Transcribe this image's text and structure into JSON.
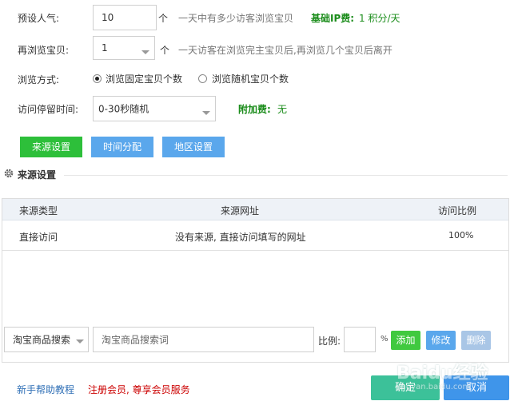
{
  "form": {
    "preset_label": "预设人气:",
    "preset_value": "10",
    "preset_unit": "个",
    "preset_hint": "一天中有多少访客浏览宝贝",
    "base_fee_label": "基础IP费:",
    "base_fee_value": "1 积分/天",
    "rebrowse_label": "再浏览宝贝:",
    "rebrowse_value": "1",
    "rebrowse_unit": "个",
    "rebrowse_hint": "一天访客在浏览完主宝贝后,再浏览几个宝贝后离开",
    "mode_label": "浏览方式:",
    "mode_option_fixed": "浏览固定宝贝个数",
    "mode_option_random": "浏览随机宝贝个数",
    "stay_label": "访问停留时间:",
    "stay_value": "0-30秒随机",
    "extra_fee_label": "附加费:",
    "extra_fee_value": "无"
  },
  "tabs": {
    "source": "来源设置",
    "time": "时间分配",
    "region": "地区设置"
  },
  "section": {
    "title": "来源设置"
  },
  "table": {
    "headers": [
      "来源类型",
      "来源网址",
      "访问比例"
    ],
    "rows": [
      {
        "type": "直接访问",
        "url": "没有来源, 直接访问填写的网址",
        "ratio": "100%"
      }
    ]
  },
  "add_row": {
    "source_select": "淘宝商品搜索",
    "keyword_placeholder": "淘宝商品搜索词",
    "ratio_label": "比例:",
    "percent": "%",
    "add": "添加",
    "edit": "修改",
    "delete": "删除"
  },
  "footer": {
    "help_link": "新手帮助教程",
    "register_link": "注册会员, 尊享会员服务",
    "confirm": "确定",
    "cancel": "取消"
  },
  "watermark": {
    "brand": "Baidu经验",
    "url": "jingyan.baidu.com"
  },
  "colors": {
    "green_button": "#2dbf3a",
    "blue_button": "#5aa7ec",
    "teal_button": "#3cc199",
    "footer_blue": "#3f95ea",
    "register_red": "#cc0000"
  }
}
